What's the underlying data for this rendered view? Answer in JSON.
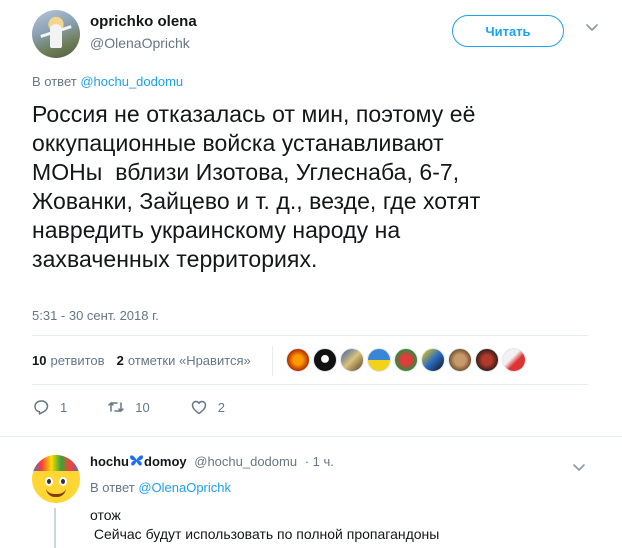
{
  "tweet": {
    "author": {
      "name": "oprichko olena",
      "handle": "@OlenaOprichk"
    },
    "follow_label": "Читать",
    "more_icon": "chevron-down-icon",
    "reply_to_prefix": "В ответ",
    "reply_to_handle": "@hochu_dodomu",
    "text_lines": [
      "Россия не отказалась от мин, поэтому её",
      "оккупационные войска устанавливают",
      "МОНы  вблизи Изотова, Углеснаба, 6-7,",
      "Жованки, Зайцево и т. д., везде, где хотят",
      "навредить украинскому народу на",
      "захваченных территориях."
    ],
    "timestamp": "5:31 - 30 сент. 2018 г.",
    "stats": {
      "retweets_count": "10",
      "retweets_label": "ретвитов",
      "likes_count": "2",
      "likes_label": "отметки «Нравится»"
    },
    "actions": {
      "reply_count": "1",
      "retweet_count": "10",
      "like_count": "2"
    },
    "colors": {
      "accent": "#1da1f2",
      "text": "#14171a",
      "muted": "#657786",
      "divider": "#e6ecf0"
    }
  },
  "reply": {
    "name": "hochu",
    "name_suffix": "domoy",
    "butterfly_icon": "butterfly-icon",
    "handle": "@hochu_dodomu",
    "time": "· 1 ч.",
    "reply_to_prefix": "В ответ",
    "reply_to_handle": "@OlenaOprichk",
    "text_lines": [
      "отож",
      " Сейчас будут использовать по полной пропагандоны"
    ]
  }
}
